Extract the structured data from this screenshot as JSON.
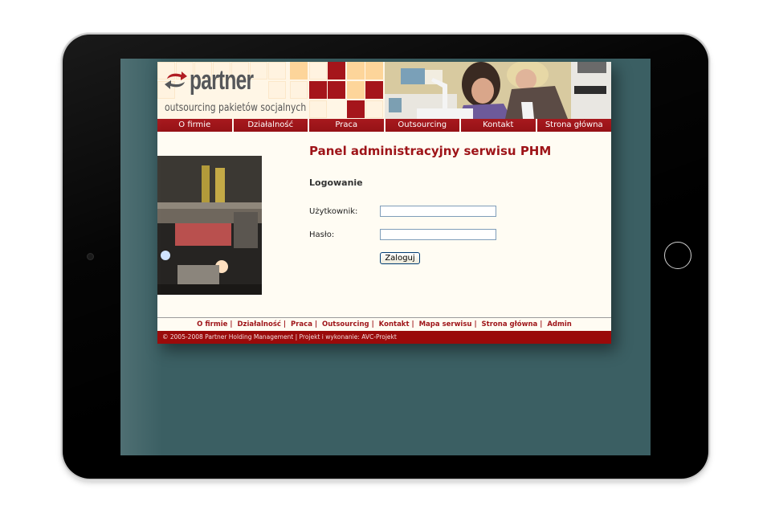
{
  "site": {
    "logo_text": "partner",
    "tagline": "outsourcing pakietów socjalnych",
    "brand_color": "#9e1418"
  },
  "nav": {
    "items": [
      {
        "label": "O firmie"
      },
      {
        "label": "Działalność"
      },
      {
        "label": "Praca"
      },
      {
        "label": "Outsourcing"
      },
      {
        "label": "Kontakt"
      },
      {
        "label": "Strona główna"
      }
    ]
  },
  "main": {
    "title": "Panel administracyjny serwisu PHM",
    "subtitle": "Logowanie",
    "username_label": "Użytkownik:",
    "username_value": "",
    "password_label": "Hasło:",
    "password_value": "",
    "login_button": "Zaloguj"
  },
  "footer": {
    "links": [
      {
        "label": "O firmie"
      },
      {
        "label": "Działalność"
      },
      {
        "label": "Praca"
      },
      {
        "label": "Outsourcing"
      },
      {
        "label": "Kontakt"
      },
      {
        "label": "Mapa serwisu"
      },
      {
        "label": "Strona główna"
      },
      {
        "label": "Admin"
      }
    ],
    "separator": "|",
    "copyright": "© 2005-2008 Partner Holding Management  |  Projekt i wykonanie: AVC-Projekt"
  },
  "icons": {
    "logo": "recycle-arrows-icon",
    "home_button": "home-button-icon",
    "camera": "camera-icon"
  }
}
